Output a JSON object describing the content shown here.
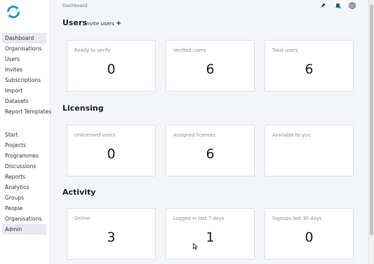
{
  "sidebar": {
    "group1": [
      "Dashboard",
      "Organisations",
      "Users",
      "Invites",
      "Subscriptions",
      "Import",
      "Datasets",
      "Report Templates"
    ],
    "group2": [
      "Start",
      "Projects",
      "Programmes",
      "Discussions",
      "Reports",
      "Analytics",
      "Groups",
      "People",
      "Organisations",
      "Admin"
    ]
  },
  "header": {
    "breadcrumb": "Dashboard",
    "icons": [
      "pin-icon",
      "notifications-icon",
      "avatar"
    ]
  },
  "users": {
    "title": "Users",
    "invite_label": "Invite users",
    "cards": [
      {
        "label": "Ready to verify",
        "value": "0"
      },
      {
        "label": "Verified users",
        "value": "6"
      },
      {
        "label": "Total users",
        "value": "6"
      }
    ]
  },
  "licensing": {
    "title": "Licensing",
    "cards": [
      {
        "label": "Unlicensed users",
        "value": "0"
      },
      {
        "label": "Assigned licenses",
        "value": "6"
      },
      {
        "label": "Available to you",
        "value": ""
      }
    ]
  },
  "activity": {
    "title": "Activity",
    "cards": [
      {
        "label": "Online",
        "value": "3"
      },
      {
        "label": "Logged in last 7 days",
        "value": "1"
      },
      {
        "label": "Signups last 30 days",
        "value": "0"
      }
    ]
  },
  "colors": {
    "accent": "#1e9bd7",
    "background": "#f4f5f8",
    "active_nav": "#e7e9ee"
  }
}
